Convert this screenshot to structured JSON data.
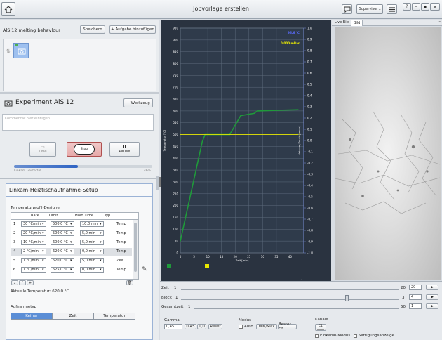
{
  "window": {
    "title": "Jobvorlage erstellen",
    "user": "Supervisor",
    "ctrl_help": "?",
    "ctrl_min": "–",
    "ctrl_max": "▪",
    "ctrl_close": "×"
  },
  "job": {
    "name": "AlSi12 melting behavlour",
    "save_label": "Speichern",
    "add_task_label": "+ Aufgabe hinzufügen"
  },
  "experiment": {
    "title": "Experiment AlSi12",
    "tool_label": "+ Werkzeug",
    "comment_placeholder": "Kommentar hier einfügen...",
    "live_label": "Live",
    "stop_label": "Stop",
    "pause_label": "Pause",
    "progress_label": "Linkam Gestartet ...",
    "progress_pct": "46%",
    "progress_value": 0.46
  },
  "setup": {
    "title": "Linkam-Heiztischaufnahme-Setup",
    "designer_title": "Temperaturprofil-Designer",
    "columns": [
      "Rate",
      "Limit",
      "Hold Time",
      "Typ"
    ],
    "rows": [
      {
        "n": "1",
        "rate": "30 °C/min",
        "limit": "500,0 °C",
        "hold": "10,0 min",
        "typ": "Temp"
      },
      {
        "n": "2",
        "rate": "20 °C/min",
        "limit": "500,0 °C",
        "hold": "5,0 min",
        "typ": "Temp"
      },
      {
        "n": "3",
        "rate": "10 °C/min",
        "limit": "600,0 °C",
        "hold": "5,0 min",
        "typ": "Temp"
      },
      {
        "n": "4",
        "rate": "2 °C/min",
        "limit": "620,0 °C",
        "hold": "0,0 min",
        "typ": "Temp"
      },
      {
        "n": "5",
        "rate": "1 °C/min",
        "limit": "620,0 °C",
        "hold": "5,0 min",
        "typ": "Zeit"
      },
      {
        "n": "6",
        "rate": "1 °C/min",
        "limit": "625,0 °C",
        "hold": "0,0 min",
        "typ": "Temp"
      }
    ],
    "current_temp": "Aktuelle Temperatur: 620,0 °C",
    "mode_title": "Aufnahmetyp",
    "modes": [
      "Keiner",
      "Zeit",
      "Temperatur"
    ],
    "active_mode": "Keiner"
  },
  "chart_data": {
    "type": "line",
    "xlabel": "Zeit [min]",
    "ylabel": "Temperatur [°C]",
    "y2label": "Vakuum/Druck [mbar]",
    "xlim": [
      0,
      45
    ],
    "ylim": [
      0,
      950
    ],
    "y2lim": [
      -1.0,
      1.0
    ],
    "x_ticks": [
      "0",
      "5",
      "10",
      "15",
      "20",
      "25",
      "30",
      "35",
      "40"
    ],
    "y_ticks": [
      "0",
      "50",
      "100",
      "150",
      "200",
      "250",
      "300",
      "350",
      "400",
      "450",
      "500",
      "550",
      "600",
      "650",
      "700",
      "750",
      "800",
      "850",
      "900",
      "950"
    ],
    "y2_ticks": [
      "-1.0",
      "-0.9",
      "-0.8",
      "-0.7",
      "-0.6",
      "-0.5",
      "-0.4",
      "-0.3",
      "-0.2",
      "-0.1",
      "0.0",
      "0.1",
      "0.2",
      "0.3",
      "0.4",
      "0.5",
      "0.6",
      "0.7",
      "0.8",
      "0.9",
      "1.0"
    ],
    "series": [
      {
        "color": "#1f9a3a",
        "x": [
          0,
          8,
          9,
          18,
          21,
          22,
          27,
          28,
          43
        ],
        "y": [
          50,
          470,
          500,
          500,
          560,
          580,
          590,
          600,
          605
        ]
      },
      {
        "color": "#e8e800",
        "x": [
          0,
          43
        ],
        "y": [
          500,
          500
        ]
      }
    ],
    "readouts": [
      "96,6 °C",
      "0,000 mBar"
    ]
  },
  "viewer": {
    "tabs": [
      "Live Bild",
      "Bild"
    ]
  },
  "bottom": {
    "zeit_label": "Zeit",
    "zeit_value": "1",
    "zeit_max": "20",
    "zeit_box": "20",
    "block_label": "Block",
    "block_value": "1",
    "block_max": "3",
    "block_box": "4",
    "gesamt_label": "Gesamtzeit",
    "gesamt_value": "1",
    "gesamt_max": "50",
    "gesamt_box": "1",
    "gamma_title": "Gamma",
    "gamma_value": "0,45",
    "gamma_preset": "0,45",
    "gamma_one": "1,0",
    "reset_label": "Reset",
    "modus_title": "Modus",
    "auto_label": "Auto",
    "minmax_label": "Min/Max",
    "bestfit_label": "Bester Fit",
    "kanale_title": "Kanale",
    "channel": "C1",
    "einkanal_label": "Einkanal-Modus",
    "saettigung_label": "Sättigungsanzeige"
  }
}
